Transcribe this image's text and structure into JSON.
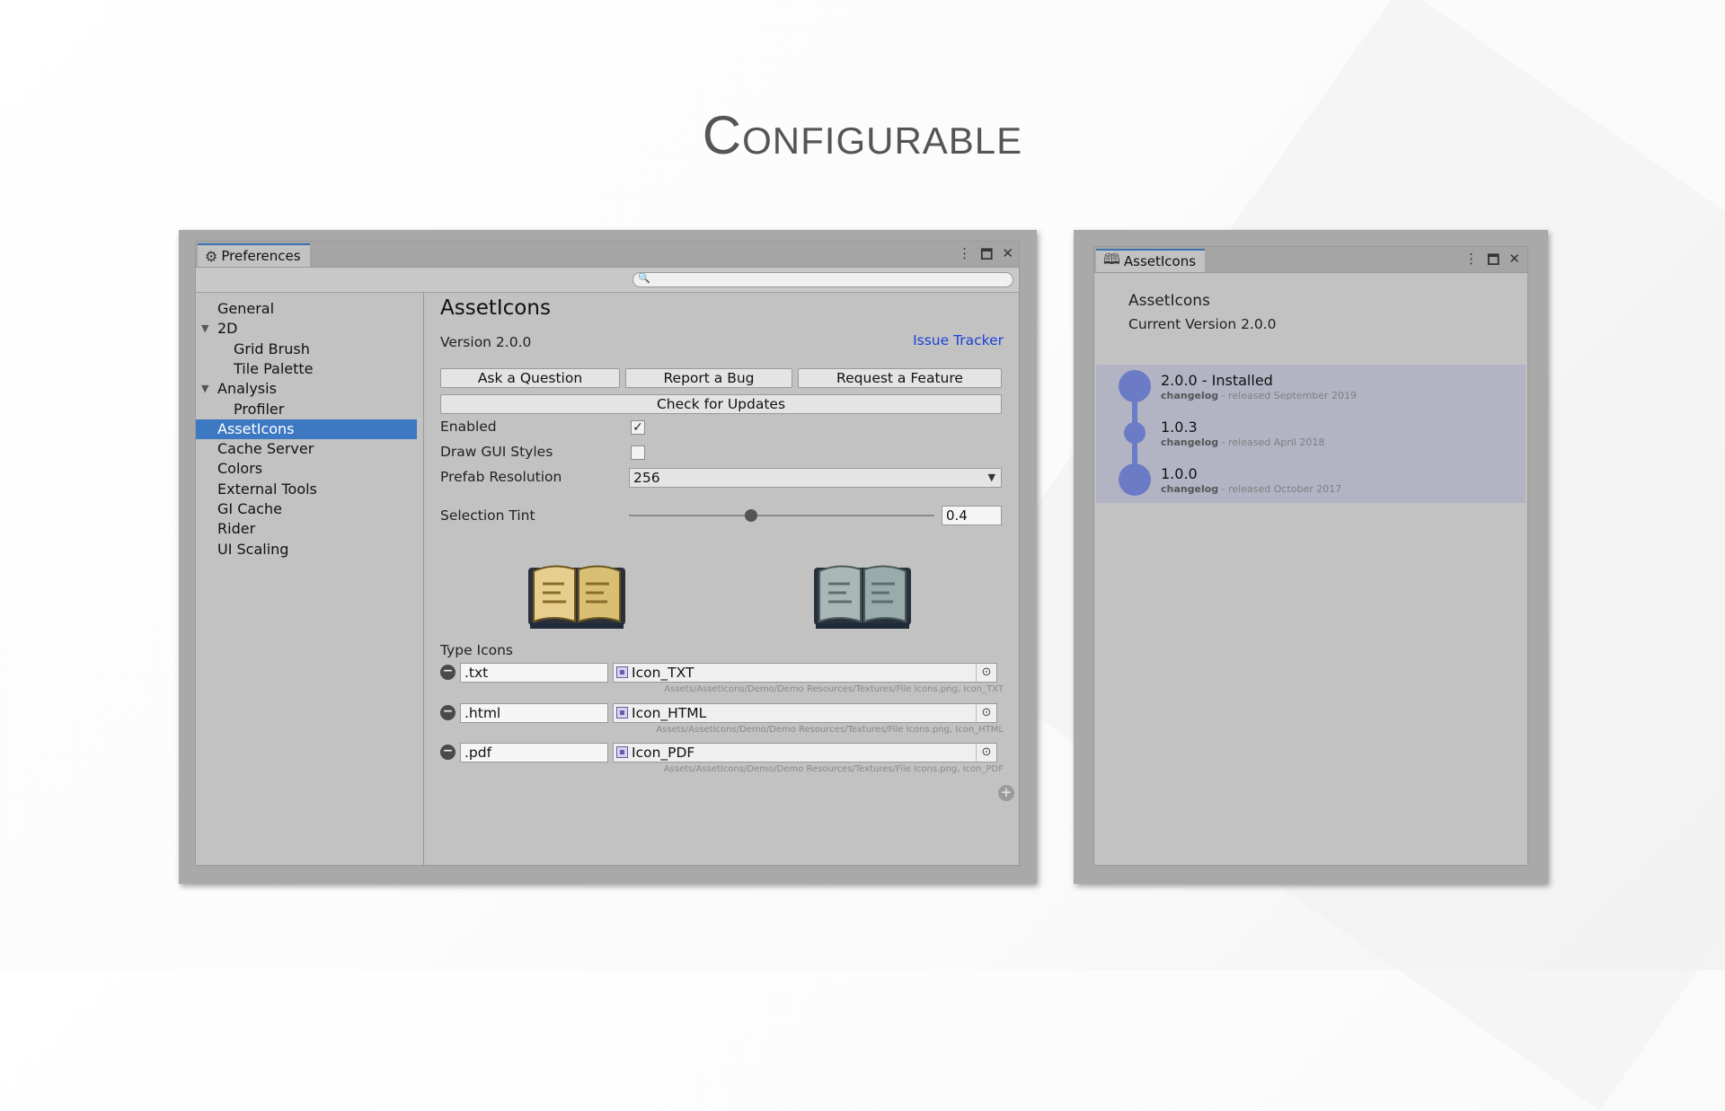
{
  "slide": {
    "title": "Configurable"
  },
  "preferences": {
    "tab_title": "Preferences",
    "search_placeholder": "",
    "sidebar": [
      {
        "label": "General",
        "indent": 0,
        "tri": ""
      },
      {
        "label": "2D",
        "indent": 0,
        "tri": "▼"
      },
      {
        "label": "Grid Brush",
        "indent": 1,
        "tri": ""
      },
      {
        "label": "Tile Palette",
        "indent": 1,
        "tri": ""
      },
      {
        "label": "Analysis",
        "indent": 0,
        "tri": "▼"
      },
      {
        "label": "Profiler",
        "indent": 1,
        "tri": ""
      },
      {
        "label": "AssetIcons",
        "indent": 0,
        "tri": "",
        "selected": true
      },
      {
        "label": "Cache Server",
        "indent": 0,
        "tri": ""
      },
      {
        "label": "Colors",
        "indent": 0,
        "tri": ""
      },
      {
        "label": "External Tools",
        "indent": 0,
        "tri": ""
      },
      {
        "label": "GI Cache",
        "indent": 0,
        "tri": ""
      },
      {
        "label": "Rider",
        "indent": 0,
        "tri": ""
      },
      {
        "label": "UI Scaling",
        "indent": 0,
        "tri": ""
      }
    ],
    "content": {
      "heading": "AssetIcons",
      "version": "Version 2.0.0",
      "issue_tracker": "Issue Tracker",
      "btn_ask": "Ask a Question",
      "btn_bug": "Report a Bug",
      "btn_feature": "Request a Feature",
      "btn_updates": "Check for Updates",
      "enabled_label": "Enabled",
      "enabled_checked": true,
      "draw_gui_label": "Draw GUI Styles",
      "draw_gui_checked": false,
      "prefab_label": "Prefab Resolution",
      "prefab_value": "256",
      "tint_label": "Selection Tint",
      "tint_value": "0.4",
      "tint_fraction": 0.4,
      "type_icons_label": "Type Icons",
      "type_icons": [
        {
          "ext": ".txt",
          "icon": "Icon_TXT",
          "path": "Assets/AssetIcons/Demo/Demo Resources/Textures/File Icons.png, Icon_TXT"
        },
        {
          "ext": ".html",
          "icon": "Icon_HTML",
          "path": "Assets/AssetIcons/Demo/Demo Resources/Textures/File Icons.png, Icon_HTML"
        },
        {
          "ext": ".pdf",
          "icon": "Icon_PDF",
          "path": "Assets/AssetIcons/Demo/Demo Resources/Textures/File Icons.png, Icon_PDF"
        }
      ]
    }
  },
  "asseticons_window": {
    "tab_title": "AssetIcons",
    "name": "AssetIcons",
    "current_version": "Current Version 2.0.0",
    "changelog": [
      {
        "version": "2.0.0 - Installed",
        "link": "changelog",
        "released": " - released September 2019"
      },
      {
        "version": "1.0.3",
        "link": "changelog",
        "released": " - released April 2018"
      },
      {
        "version": "1.0.0",
        "link": "changelog",
        "released": " - released October 2017"
      }
    ]
  },
  "colors": {
    "accent": "#3d78c2",
    "link": "#1a3fd6",
    "timeline": "#6c7bc6"
  }
}
